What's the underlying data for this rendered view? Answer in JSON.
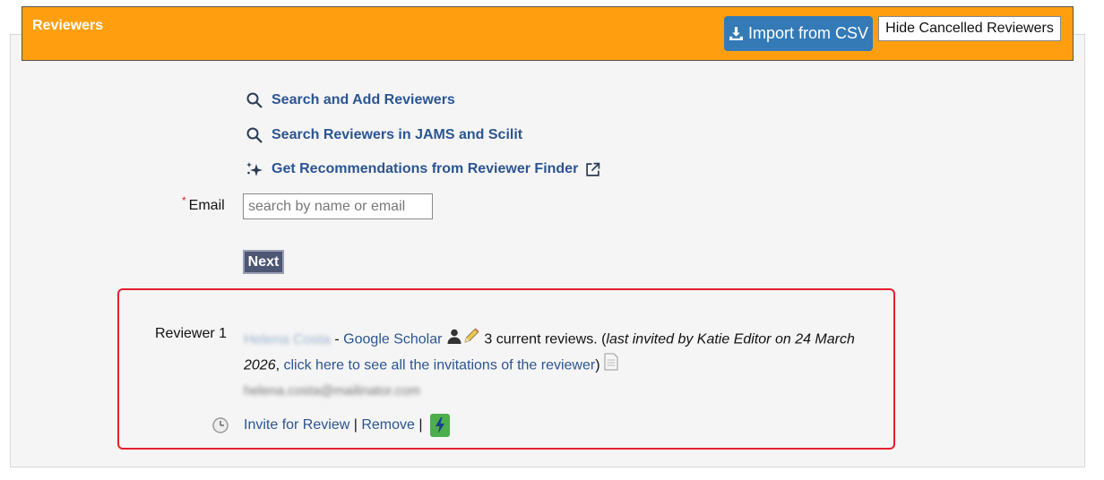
{
  "header": {
    "title": "Reviewers",
    "import_csv_label": "Import from CSV",
    "hide_cancelled_label": "Hide Cancelled Reviewers"
  },
  "links": [
    {
      "icon": "search-icon",
      "label": "Search and Add Reviewers"
    },
    {
      "icon": "search-icon",
      "label": "Search Reviewers in JAMS and Scilit"
    },
    {
      "icon": "sparkle-icon",
      "label": "Get Recommendations from Reviewer Finder"
    }
  ],
  "form": {
    "email_label": "Email",
    "required_mark": "*",
    "email_placeholder": "search by name or email",
    "email_value": "",
    "next_label": "Next"
  },
  "reviewer": {
    "label": "Reviewer 1",
    "name": "Helena Costa",
    "separator": " - ",
    "google_scholar": "Google Scholar",
    "reviews_text": " 3 current reviews. (",
    "last_invited": "last invited by Katie Editor on 24 March 2026",
    "comma": ", ",
    "invitations_link": "click here to see all the invitations of the reviewer",
    "close_paren": ")",
    "email": "helena.costa@mailinator.com",
    "invite_label": "Invite for Review",
    "pipe": " | ",
    "remove_label": "Remove",
    "pipe2": " | "
  },
  "colors": {
    "header_bg": "#ff9f0f",
    "primary_btn": "#337ab7",
    "link": "#2b5592",
    "highlight_border": "#e4202e",
    "bolt_btn": "#4cae4c"
  }
}
